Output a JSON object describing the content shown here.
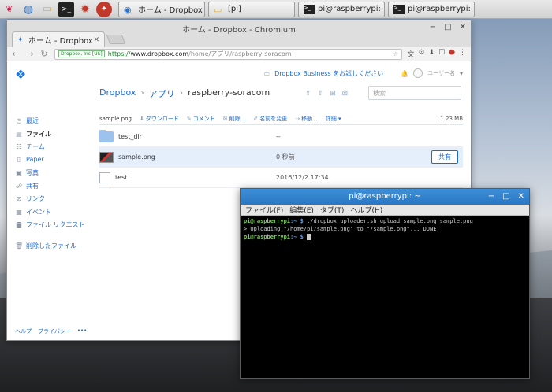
{
  "taskbar": {
    "tasks": [
      {
        "label": "ホーム - Dropbox - C..."
      },
      {
        "label": "[pi]"
      },
      {
        "label": "pi@raspberrypi: ~"
      },
      {
        "label": "pi@raspberrypi: ~"
      }
    ]
  },
  "browser": {
    "window_title": "ホーム - Dropbox - Chromium",
    "tab_label": "ホーム - Dropbox",
    "secure_badge": "Dropbox, Inc [US]",
    "url_scheme": "https://",
    "url_host": "www.dropbox.com",
    "url_path": "/home/アプリ/raspberry-soracom"
  },
  "dropbox": {
    "business_link": "Dropbox Business をお試しください",
    "username": "ユーザー名",
    "breadcrumb": [
      "Dropbox",
      "アプリ",
      "raspberry-soracom"
    ],
    "search_placeholder": "検索",
    "sidebar": [
      {
        "label": "最近",
        "icon": "clock-icon"
      },
      {
        "label": "ファイル",
        "icon": "files-icon"
      },
      {
        "label": "チーム",
        "icon": "team-icon"
      },
      {
        "label": "Paper",
        "icon": "paper-icon"
      },
      {
        "label": "写真",
        "icon": "photo-icon"
      },
      {
        "label": "共有",
        "icon": "share-icon"
      },
      {
        "label": "リンク",
        "icon": "link-icon"
      },
      {
        "label": "イベント",
        "icon": "event-icon"
      },
      {
        "label": "ファイル リクエスト",
        "icon": "request-icon"
      },
      {
        "label": "削除したファイル",
        "icon": "trash-icon"
      }
    ],
    "footer": [
      "ヘルプ",
      "プライバシー",
      "•••"
    ],
    "actions": {
      "selected": "sample.png",
      "download": "ダウンロード",
      "comment": "コメント",
      "delete": "削除...",
      "rename": "名前を変更",
      "move": "移動...",
      "more": "詳細 ▾",
      "size": "1.23 MB"
    },
    "files": [
      {
        "name": "test_dir",
        "date": "--",
        "type": "folder"
      },
      {
        "name": "sample.png",
        "date": "0 秒前",
        "type": "image",
        "share": "共有"
      },
      {
        "name": "test",
        "date": "2016/12/2 17:34",
        "type": "file"
      }
    ]
  },
  "terminal": {
    "title": "pi@raspberrypi: ~",
    "menu": [
      "ファイル(F)",
      "編集(E)",
      "タブ(T)",
      "ヘルプ(H)"
    ],
    "prompt_user": "pi@raspberrypi",
    "prompt_path": ":~ $",
    "command": " ./dropbox_uploader.sh upload sample.png sample.png",
    "output": " > Uploading \"/home/pi/sample.png\" to \"/sample.png\"... DONE"
  }
}
